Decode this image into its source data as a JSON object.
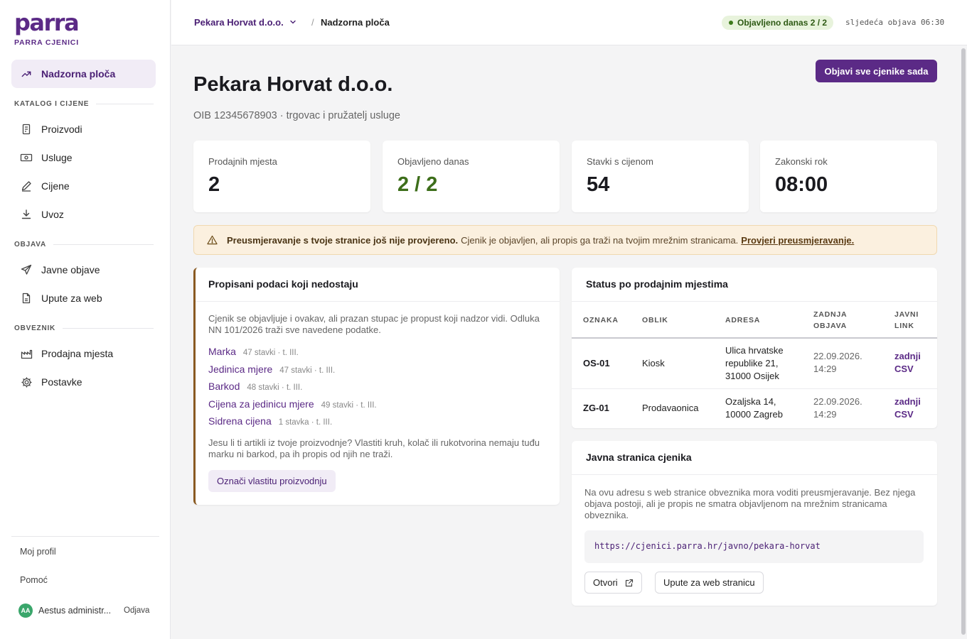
{
  "brand": {
    "logo_text": "parra",
    "subtitle": "PARRA CJENICI",
    "accent": "#5b2a86"
  },
  "sidebar": {
    "active": {
      "label": "Nadzorna ploča",
      "icon": "trending-up-icon"
    },
    "sections": [
      {
        "title": "KATALOG I CIJENE",
        "items": [
          {
            "label": "Proizvodi",
            "icon": "receipt-icon"
          },
          {
            "label": "Usluge",
            "icon": "banknote-icon"
          },
          {
            "label": "Cijene",
            "icon": "pencil-icon"
          },
          {
            "label": "Uvoz",
            "icon": "download-icon"
          }
        ]
      },
      {
        "title": "OBJAVA",
        "items": [
          {
            "label": "Javne objave",
            "icon": "send-icon"
          },
          {
            "label": "Upute za web",
            "icon": "file-icon"
          }
        ]
      },
      {
        "title": "OBVEZNIK",
        "items": [
          {
            "label": "Prodajna mjesta",
            "icon": "factory-icon"
          },
          {
            "label": "Postavke",
            "icon": "gear-icon"
          }
        ]
      }
    ],
    "footer": {
      "profile": "Moj profil",
      "help": "Pomoć",
      "avatar_initials": "AA",
      "user_name": "Aestus administr...",
      "logout": "Odjava"
    }
  },
  "topbar": {
    "company": "Pekara Horvat d.o.o.",
    "separator": "/",
    "page": "Nadzorna ploča",
    "badge": "Objavljeno danas 2 / 2",
    "next_publish": "sljedeća objava 06:30"
  },
  "header": {
    "title": "Pekara Horvat d.o.o.",
    "subtitle": "OIB 12345678903 · trgovac i pružatelj usluge",
    "primary_button": "Objavi sve cjenike sada"
  },
  "stats": [
    {
      "label": "Prodajnih mjesta",
      "value": "2"
    },
    {
      "label": "Objavljeno danas",
      "value": "2 / 2"
    },
    {
      "label": "Stavki s cijenom",
      "value": "54"
    },
    {
      "label": "Zakonski rok",
      "value": "08:00"
    }
  ],
  "alert": {
    "bold": "Preusmjeravanje s tvoje stranice još nije provjereno.",
    "text": "Cjenik je objavljen, ali propis ga traži na tvojim mrežnim stranicama.",
    "link": "Provjeri preusmjeravanje."
  },
  "missing": {
    "title": "Propisani podaci koji nedostaju",
    "intro": "Cjenik se objavljuje i ovakav, ali prazan stupac je propust koji nadzor vidi. Odluka NN 101/2026 traži sve navedene podatke.",
    "fields": [
      {
        "name": "Marka",
        "meta": "47 stavki · t. III."
      },
      {
        "name": "Jedinica mjere",
        "meta": "47 stavki · t. III."
      },
      {
        "name": "Barkod",
        "meta": "48 stavki · t. III."
      },
      {
        "name": "Cijena za jedinicu mjere",
        "meta": "49 stavki · t. III."
      },
      {
        "name": "Sidrena cijena",
        "meta": "1 stavka · t. III."
      }
    ],
    "question": "Jesu li ti artikli iz tvoje proizvodnje? Vlastiti kruh, kolač ili rukotvorina nemaju tuđu marku ni barkod, pa ih propis od njih ne traži.",
    "button": "Označi vlastitu proizvodnju"
  },
  "status": {
    "title": "Status po prodajnim mjestima",
    "columns": [
      "OZNAKA",
      "OBLIK",
      "ADRESA",
      "ZADNJA OBJAVA",
      "JAVNI LINK"
    ],
    "rows": [
      {
        "code": "OS-01",
        "type": "Kiosk",
        "address": "Ulica hrvatske republike 21, 31000 Osijek",
        "last": "22.09.2026. 14:29",
        "link": "zadnji CSV"
      },
      {
        "code": "ZG-01",
        "type": "Prodavaonica",
        "address": "Ozaljska 14, 10000 Zagreb",
        "last": "22.09.2026. 14:29",
        "link": "zadnji CSV"
      }
    ]
  },
  "public_page": {
    "title": "Javna stranica cjenika",
    "intro": "Na ovu adresu s web stranice obveznika mora voditi preusmjeravanje. Bez njega objava postoji, ali je propis ne smatra objavljenom na mrežnim stranicama obveznika.",
    "url": "https://cjenici.parra.hr/javno/pekara-horvat",
    "open_button": "Otvori",
    "guide_button": "Upute za web stranicu"
  }
}
